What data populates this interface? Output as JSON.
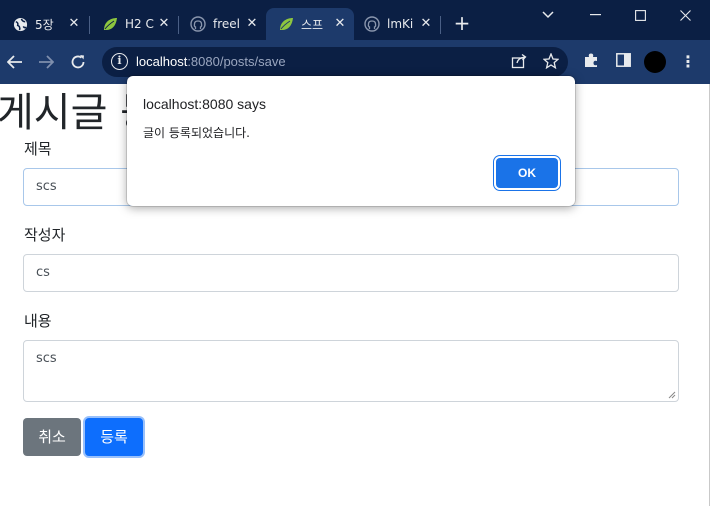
{
  "browser": {
    "tabs": [
      {
        "title": "5장",
        "icon": "globe-icon",
        "active": false
      },
      {
        "title": "H2 C",
        "icon": "spring-leaf-icon",
        "active": false
      },
      {
        "title": "freel",
        "icon": "github-icon",
        "active": false
      },
      {
        "title": "스프",
        "icon": "spring-leaf-icon",
        "active": true
      },
      {
        "title": "lmKi",
        "icon": "github-icon",
        "active": false
      }
    ],
    "new_tab_label": "+",
    "address": {
      "host": "localhost",
      "rest": ":8080/posts/save"
    }
  },
  "page": {
    "title": "게시글 등록",
    "fields": {
      "title": {
        "label": "제목",
        "value": "scs"
      },
      "author": {
        "label": "작성자",
        "value": "cs"
      },
      "content": {
        "label": "내용",
        "value": "scs"
      }
    },
    "buttons": {
      "cancel": "취소",
      "save": "등록"
    }
  },
  "dialog": {
    "origin": "localhost:8080 says",
    "message": "글이 등록되었습니다.",
    "ok_label": "OK"
  },
  "colors": {
    "titlebar": "#0b1f44",
    "toolbar": "#1d3a6b",
    "primary": "#0d6efd",
    "secondary": "#6c757d",
    "dialog_button": "#1a73e8"
  }
}
